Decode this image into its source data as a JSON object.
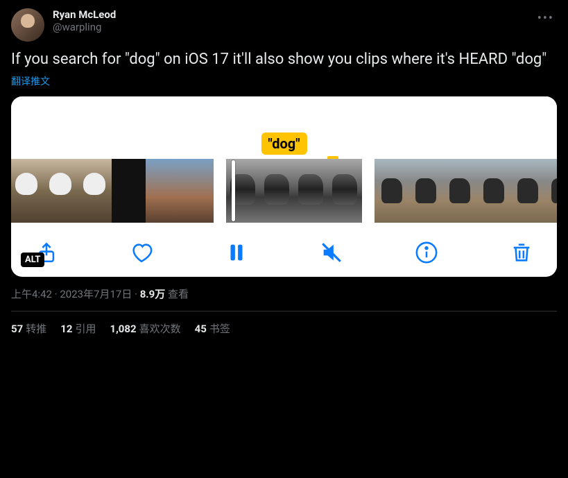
{
  "user": {
    "display_name": "Ryan McLeod",
    "handle": "@warpling"
  },
  "tweet_text": "If you search for \"dog\" on iOS 17 it'll also show you clips where it's HEARD \"dog\"",
  "translate_label": "翻译推文",
  "media": {
    "caption_tag": "\"dog\"",
    "alt_badge": "ALT"
  },
  "meta": {
    "time": "上午4:42",
    "date": "2023年7月17日",
    "views_count": "8.9万",
    "views_label": "查看"
  },
  "stats": {
    "retweets": {
      "count": "57",
      "label": "转推"
    },
    "quotes": {
      "count": "12",
      "label": "引用"
    },
    "likes": {
      "count": "1,082",
      "label": "喜欢次数"
    },
    "bookmarks": {
      "count": "45",
      "label": "书签"
    }
  }
}
